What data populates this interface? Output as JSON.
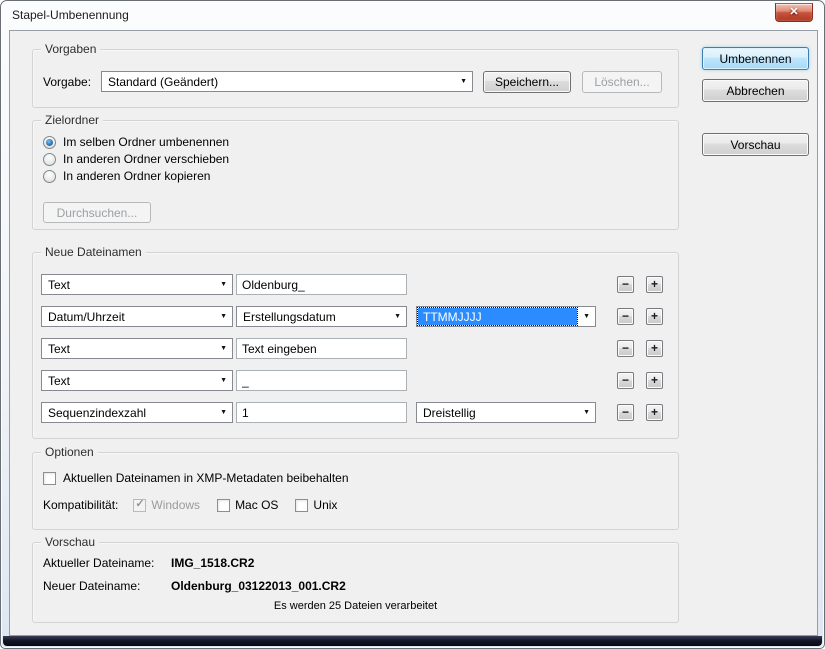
{
  "window": {
    "title": "Stapel-Umbenennung"
  },
  "icons": {
    "close": "✕",
    "dropdown": "▼",
    "minus": "−",
    "plus": "+",
    "check": "✓"
  },
  "colors": {
    "selection_highlight": "#2b8cff",
    "close_button_red": "#c8402f",
    "dialog_background": "#f0f0f0",
    "default_button_border": "#3c7fb1"
  },
  "actions": {
    "rename": "Umbenennen",
    "cancel": "Abbrechen",
    "preview": "Vorschau"
  },
  "presets": {
    "group_label": "Vorgaben",
    "field_label": "Vorgabe:",
    "selected_preset": "Standard (Geändert)",
    "save_label": "Speichern...",
    "delete_label": "Löschen..."
  },
  "destination": {
    "group_label": "Zielordner",
    "options": [
      {
        "label": "Im selben Ordner umbenennen",
        "selected": true
      },
      {
        "label": "In anderen Ordner verschieben",
        "selected": false
      },
      {
        "label": "In anderen Ordner kopieren",
        "selected": false
      }
    ],
    "browse_label": "Durchsuchen..."
  },
  "filenames": {
    "group_label": "Neue Dateinamen",
    "rows": [
      {
        "type": "Text",
        "value": "Oldenburg_"
      },
      {
        "type": "Datum/Uhrzeit",
        "option1": "Erstellungsdatum",
        "option2": "TTMMJJJJ",
        "option2_highlighted": true
      },
      {
        "type": "Text",
        "value": "Text eingeben"
      },
      {
        "type": "Text",
        "value": "_"
      },
      {
        "type": "Sequenzindexzahl",
        "value": "1",
        "option2": "Dreistellig"
      }
    ]
  },
  "options": {
    "group_label": "Optionen",
    "xmp_label": "Aktuellen Dateinamen in XMP-Metadaten beibehalten",
    "xmp_checked": false,
    "compatibility_label": "Kompatibilität:",
    "systems": [
      {
        "label": "Windows",
        "checked": true,
        "disabled": true
      },
      {
        "label": "Mac OS",
        "checked": false,
        "disabled": false
      },
      {
        "label": "Unix",
        "checked": false,
        "disabled": false
      }
    ]
  },
  "preview": {
    "group_label": "Vorschau",
    "current_label": "Aktueller Dateiname:",
    "current_filename": "IMG_1518.CR2",
    "new_label": "Neuer Dateiname:",
    "new_filename": "Oldenburg_03122013_001.CR2",
    "status_note": "Es werden 25 Dateien verarbeitet"
  }
}
